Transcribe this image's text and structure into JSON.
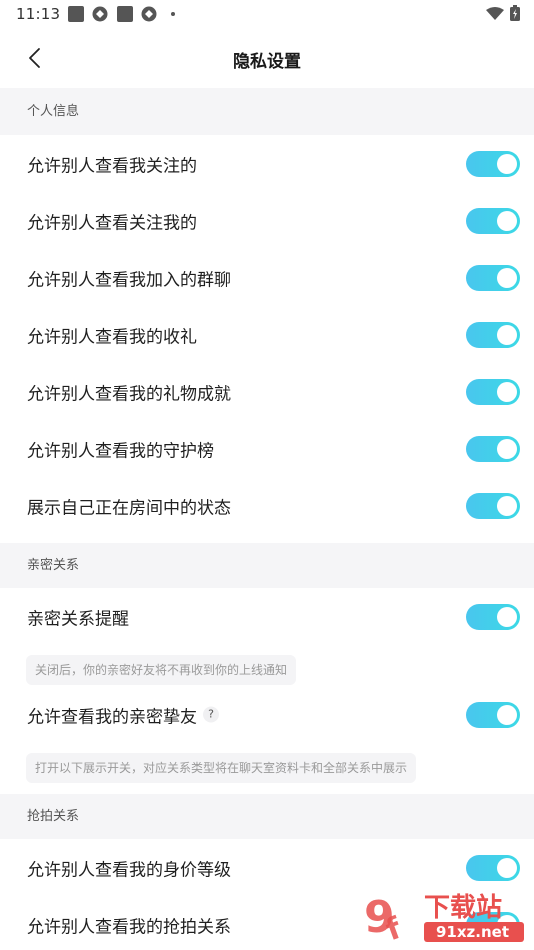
{
  "status_bar": {
    "time": "11:13"
  },
  "header": {
    "title": "隐私设置"
  },
  "sections": [
    {
      "title": "个人信息",
      "rows": [
        {
          "label": "允许别人查看我关注的",
          "on": true
        },
        {
          "label": "允许别人查看关注我的",
          "on": true
        },
        {
          "label": "允许别人查看我加入的群聊",
          "on": true
        },
        {
          "label": "允许别人查看我的收礼",
          "on": true
        },
        {
          "label": "允许别人查看我的礼物成就",
          "on": true
        },
        {
          "label": "允许别人查看我的守护榜",
          "on": true
        },
        {
          "label": "展示自己正在房间中的状态",
          "on": true
        }
      ]
    },
    {
      "title": "亲密关系",
      "rows": [
        {
          "label": "亲密关系提醒",
          "on": true
        },
        {
          "label": "允许查看我的亲密挚友",
          "on": true,
          "help": "?"
        }
      ],
      "notes": [
        "关闭后，你的亲密好友将不再收到你的上线通知",
        "打开以下展示开关，对应关系类型将在聊天室资料卡和全部关系中展示"
      ]
    },
    {
      "title": "抢拍关系",
      "rows": [
        {
          "label": "允许别人查看我的身价等级",
          "on": true
        },
        {
          "label": "允许别人查看我的抢拍关系",
          "on": true
        }
      ]
    }
  ],
  "colors": {
    "toggle_on_start": "#49c6ee",
    "toggle_on_end": "#3cd9e6",
    "section_bg": "#f5f5f7"
  },
  "watermark": {
    "text": "下载站",
    "url_text": "91xz.net"
  }
}
